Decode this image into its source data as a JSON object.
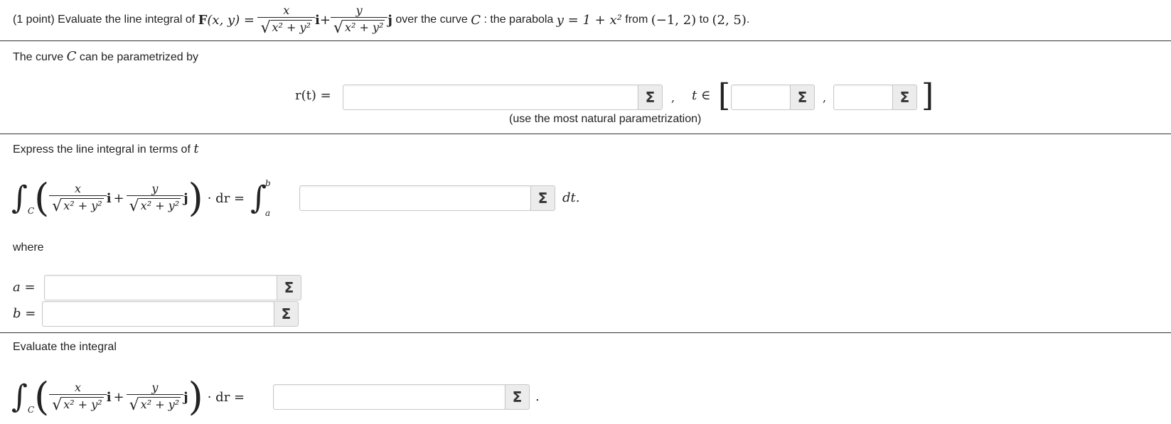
{
  "problem": {
    "points": "(1 point)",
    "intro": "Evaluate the line integral of",
    "field_name": "F",
    "field_args": "(x, y) =",
    "over": "over the curve",
    "curve_name": "C",
    "colon_text": ": the parabola",
    "parabola": "y = 1 + x²",
    "from_word": "from",
    "start_point": "(−1, 2)",
    "to_word": "to",
    "end_point": "(2, 5)",
    "period": "."
  },
  "math": {
    "x": "x",
    "y": "y",
    "den": "x² + y²",
    "i": "i",
    "j": "j",
    "plus": "+",
    "sqrt": "√",
    "int": "∫",
    "sub_c": "C",
    "lparen": "(",
    "rparen": ")",
    "dot_dr": "· dr =",
    "lower_a": "a",
    "upper_b": "b",
    "dt": "dt.",
    "dot_end": "."
  },
  "section1": {
    "text_before": "The curve",
    "curve_name": "C",
    "text_after": "can be parametrized by",
    "r_label": "r(t) =",
    "comma1": ",",
    "t_in": "t ∈",
    "lbracket": "[",
    "comma2": ",",
    "rbracket": "]",
    "hint": "(use the most natural parametrization)"
  },
  "section2": {
    "text": "Express the line integral in terms of",
    "t": "t",
    "where": "where",
    "a_label": "a =",
    "b_label": "b ="
  },
  "section3": {
    "text": "Evaluate the integral"
  },
  "inputs": {
    "r_value": "",
    "t_start": "",
    "t_end": "",
    "integrand": "",
    "a_value": "",
    "b_value": "",
    "result": ""
  },
  "icons": {
    "sigma": "Σ"
  }
}
